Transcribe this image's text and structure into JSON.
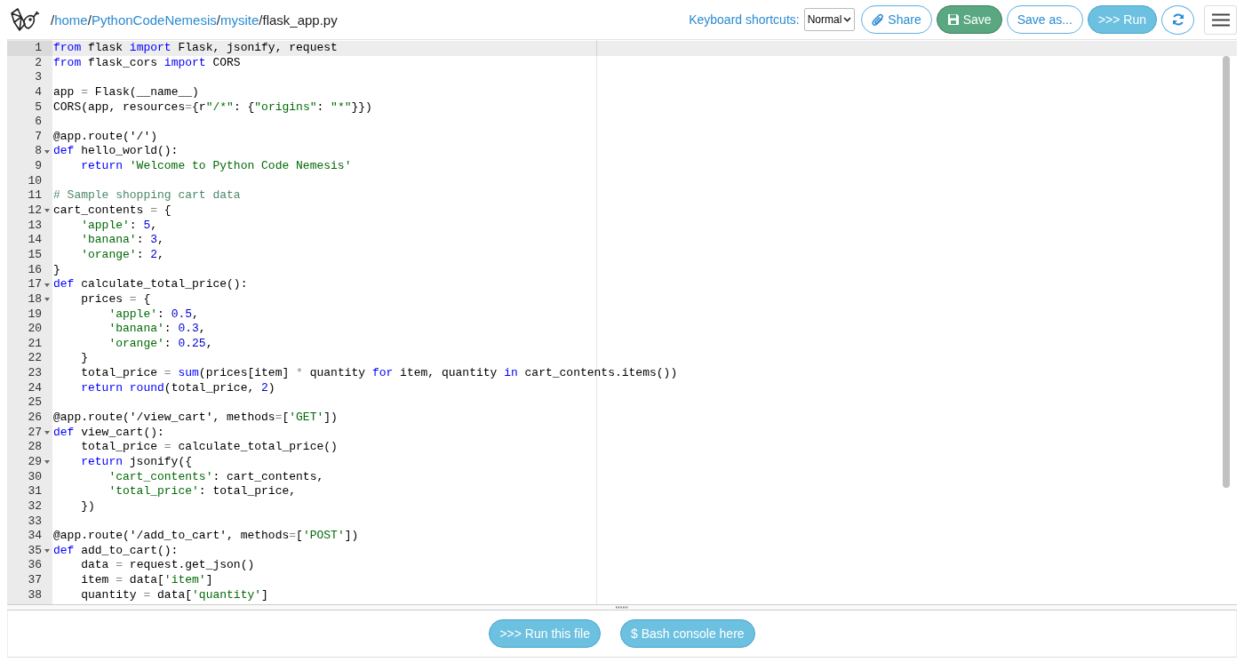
{
  "header": {
    "path": [
      {
        "kind": "sep",
        "text": "/"
      },
      {
        "kind": "link",
        "text": "home"
      },
      {
        "kind": "sep",
        "text": "/"
      },
      {
        "kind": "link",
        "text": "PythonCodeNemesis"
      },
      {
        "kind": "sep",
        "text": "/"
      },
      {
        "kind": "link",
        "text": "mysite"
      },
      {
        "kind": "sep",
        "text": "/"
      },
      {
        "kind": "file",
        "text": "flask_app.py"
      }
    ],
    "shortcuts_label": "Keyboard shortcuts:",
    "shortcuts_select": "Normal",
    "buttons": [
      {
        "kind": "share",
        "label": "Share"
      },
      {
        "kind": "save",
        "label": "Save"
      },
      {
        "kind": "save_as",
        "label": "Save as..."
      },
      {
        "kind": "run",
        "label": ">>> Run"
      },
      {
        "kind": "refresh"
      },
      {
        "kind": "menu"
      }
    ]
  },
  "editor": {
    "lines": [
      {
        "number": "1",
        "active": true,
        "foldable": false,
        "tokens": [
          {
            "kind": "kw",
            "text": "from"
          },
          {
            "kind": "plain",
            "text": " flask "
          },
          {
            "kind": "kw",
            "text": "import"
          },
          {
            "kind": "plain",
            "text": " Flask, jsonify, request"
          }
        ]
      },
      {
        "number": "2",
        "active": false,
        "foldable": false,
        "tokens": [
          {
            "kind": "kw",
            "text": "from"
          },
          {
            "kind": "plain",
            "text": " flask_cors "
          },
          {
            "kind": "kw",
            "text": "import"
          },
          {
            "kind": "plain",
            "text": " CORS"
          }
        ]
      },
      {
        "number": "3",
        "active": false,
        "foldable": false
      },
      {
        "number": "4",
        "active": false,
        "foldable": false,
        "tokens": [
          {
            "kind": "plain",
            "text": "app "
          },
          {
            "kind": "op",
            "text": "="
          },
          {
            "kind": "plain",
            "text": " Flask(__name__)"
          }
        ]
      },
      {
        "number": "5",
        "active": false,
        "foldable": false,
        "tokens": [
          {
            "kind": "plain",
            "text": "CORS(app, resources"
          },
          {
            "kind": "op",
            "text": "="
          },
          {
            "kind": "plain",
            "text": "{r"
          },
          {
            "kind": "str",
            "text": "\"/*\""
          },
          {
            "kind": "plain",
            "text": ": {"
          },
          {
            "kind": "str",
            "text": "\"origins\""
          },
          {
            "kind": "plain",
            "text": ": "
          },
          {
            "kind": "str",
            "text": "\"*\""
          },
          {
            "kind": "plain",
            "text": "}})"
          }
        ]
      },
      {
        "number": "6",
        "active": false,
        "foldable": false
      },
      {
        "number": "7",
        "active": false,
        "foldable": false,
        "tokens": [
          {
            "kind": "plain",
            "text": "@app.route('/')"
          }
        ]
      },
      {
        "number": "8",
        "active": false,
        "foldable": true,
        "tokens": [
          {
            "kind": "kw",
            "text": "def"
          },
          {
            "kind": "plain",
            "text": " hello_world():"
          }
        ]
      },
      {
        "number": "9",
        "active": false,
        "foldable": false,
        "tokens": [
          {
            "kind": "kw",
            "text": "    return"
          },
          {
            "kind": "str",
            "text": " 'Welcome to Python Code Nemesis'"
          }
        ]
      },
      {
        "number": "10",
        "active": false,
        "foldable": false
      },
      {
        "number": "11",
        "active": false,
        "foldable": false,
        "tokens": [
          {
            "kind": "com",
            "text": "# Sample shopping cart data"
          }
        ]
      },
      {
        "number": "12",
        "active": false,
        "foldable": true,
        "tokens": [
          {
            "kind": "plain",
            "text": "cart_contents "
          },
          {
            "kind": "op",
            "text": "="
          },
          {
            "kind": "plain",
            "text": " {"
          }
        ]
      },
      {
        "number": "13",
        "active": false,
        "foldable": false,
        "tokens": [
          {
            "kind": "str",
            "text": "    'apple'"
          },
          {
            "kind": "plain",
            "text": ": "
          },
          {
            "kind": "num",
            "text": "5"
          },
          {
            "kind": "plain",
            "text": ","
          }
        ]
      },
      {
        "number": "14",
        "active": false,
        "foldable": false,
        "tokens": [
          {
            "kind": "str",
            "text": "    'banana'"
          },
          {
            "kind": "plain",
            "text": ": "
          },
          {
            "kind": "num",
            "text": "3"
          },
          {
            "kind": "plain",
            "text": ","
          }
        ]
      },
      {
        "number": "15",
        "active": false,
        "foldable": false,
        "tokens": [
          {
            "kind": "str",
            "text": "    'orange'"
          },
          {
            "kind": "plain",
            "text": ": "
          },
          {
            "kind": "num",
            "text": "2"
          },
          {
            "kind": "plain",
            "text": ","
          }
        ]
      },
      {
        "number": "16",
        "active": false,
        "foldable": false,
        "tokens": [
          {
            "kind": "plain",
            "text": "}"
          }
        ]
      },
      {
        "number": "17",
        "active": false,
        "foldable": true,
        "tokens": [
          {
            "kind": "kw",
            "text": "def"
          },
          {
            "kind": "plain",
            "text": " calculate_total_price():"
          }
        ]
      },
      {
        "number": "18",
        "active": false,
        "foldable": true,
        "tokens": [
          {
            "kind": "plain",
            "text": "    prices "
          },
          {
            "kind": "op",
            "text": "="
          },
          {
            "kind": "plain",
            "text": " {"
          }
        ]
      },
      {
        "number": "19",
        "active": false,
        "foldable": false,
        "tokens": [
          {
            "kind": "str",
            "text": "        'apple'"
          },
          {
            "kind": "plain",
            "text": ": "
          },
          {
            "kind": "num",
            "text": "0.5"
          },
          {
            "kind": "plain",
            "text": ","
          }
        ]
      },
      {
        "number": "20",
        "active": false,
        "foldable": false,
        "tokens": [
          {
            "kind": "str",
            "text": "        'banana'"
          },
          {
            "kind": "plain",
            "text": ": "
          },
          {
            "kind": "num",
            "text": "0.3"
          },
          {
            "kind": "plain",
            "text": ","
          }
        ]
      },
      {
        "number": "21",
        "active": false,
        "foldable": false,
        "tokens": [
          {
            "kind": "str",
            "text": "        'orange'"
          },
          {
            "kind": "plain",
            "text": ": "
          },
          {
            "kind": "num",
            "text": "0.25"
          },
          {
            "kind": "plain",
            "text": ","
          }
        ]
      },
      {
        "number": "22",
        "active": false,
        "foldable": false,
        "tokens": [
          {
            "kind": "plain",
            "text": "    }"
          }
        ]
      },
      {
        "number": "23",
        "active": false,
        "foldable": false,
        "tokens": [
          {
            "kind": "plain",
            "text": "    total_price "
          },
          {
            "kind": "op",
            "text": "="
          },
          {
            "kind": "kw",
            "text": " sum"
          },
          {
            "kind": "plain",
            "text": "(prices[item] "
          },
          {
            "kind": "op",
            "text": "*"
          },
          {
            "kind": "plain",
            "text": " quantity "
          },
          {
            "kind": "kw",
            "text": "for"
          },
          {
            "kind": "plain",
            "text": " item, quantity "
          },
          {
            "kind": "kw",
            "text": "in"
          },
          {
            "kind": "plain",
            "text": " cart_contents.items())"
          }
        ]
      },
      {
        "number": "24",
        "active": false,
        "foldable": false,
        "tokens": [
          {
            "kind": "kw",
            "text": "    return round"
          },
          {
            "kind": "plain",
            "text": "(total_price, "
          },
          {
            "kind": "num",
            "text": "2"
          },
          {
            "kind": "plain",
            "text": ")"
          }
        ]
      },
      {
        "number": "25",
        "active": false,
        "foldable": false
      },
      {
        "number": "26",
        "active": false,
        "foldable": false,
        "tokens": [
          {
            "kind": "plain",
            "text": "@app.route('/view_cart', methods"
          },
          {
            "kind": "op",
            "text": "="
          },
          {
            "kind": "plain",
            "text": "["
          },
          {
            "kind": "str",
            "text": "'GET'"
          },
          {
            "kind": "plain",
            "text": "])"
          }
        ]
      },
      {
        "number": "27",
        "active": false,
        "foldable": true,
        "tokens": [
          {
            "kind": "kw",
            "text": "def"
          },
          {
            "kind": "plain",
            "text": " view_cart():"
          }
        ]
      },
      {
        "number": "28",
        "active": false,
        "foldable": false,
        "tokens": [
          {
            "kind": "plain",
            "text": "    total_price "
          },
          {
            "kind": "op",
            "text": "="
          },
          {
            "kind": "plain",
            "text": " calculate_total_price()"
          }
        ]
      },
      {
        "number": "29",
        "active": false,
        "foldable": true,
        "tokens": [
          {
            "kind": "kw",
            "text": "    return"
          },
          {
            "kind": "plain",
            "text": " jsonify({"
          }
        ]
      },
      {
        "number": "30",
        "active": false,
        "foldable": false,
        "tokens": [
          {
            "kind": "str",
            "text": "        'cart_contents'"
          },
          {
            "kind": "plain",
            "text": ": cart_contents,"
          }
        ]
      },
      {
        "number": "31",
        "active": false,
        "foldable": false,
        "tokens": [
          {
            "kind": "str",
            "text": "        'total_price'"
          },
          {
            "kind": "plain",
            "text": ": total_price,"
          }
        ]
      },
      {
        "number": "32",
        "active": false,
        "foldable": false,
        "tokens": [
          {
            "kind": "plain",
            "text": "    })"
          }
        ]
      },
      {
        "number": "33",
        "active": false,
        "foldable": false
      },
      {
        "number": "34",
        "active": false,
        "foldable": false,
        "tokens": [
          {
            "kind": "plain",
            "text": "@app.route('/add_to_cart', methods"
          },
          {
            "kind": "op",
            "text": "="
          },
          {
            "kind": "plain",
            "text": "["
          },
          {
            "kind": "str",
            "text": "'POST'"
          },
          {
            "kind": "plain",
            "text": "])"
          }
        ]
      },
      {
        "number": "35",
        "active": false,
        "foldable": true,
        "tokens": [
          {
            "kind": "kw",
            "text": "def"
          },
          {
            "kind": "plain",
            "text": " add_to_cart():"
          }
        ]
      },
      {
        "number": "36",
        "active": false,
        "foldable": false,
        "tokens": [
          {
            "kind": "plain",
            "text": "    data "
          },
          {
            "kind": "op",
            "text": "="
          },
          {
            "kind": "plain",
            "text": " request.get_json()"
          }
        ]
      },
      {
        "number": "37",
        "active": false,
        "foldable": false,
        "tokens": [
          {
            "kind": "plain",
            "text": "    item "
          },
          {
            "kind": "op",
            "text": "="
          },
          {
            "kind": "plain",
            "text": " data["
          },
          {
            "kind": "str",
            "text": "'item'"
          },
          {
            "kind": "plain",
            "text": "]"
          }
        ]
      },
      {
        "number": "38",
        "active": false,
        "foldable": false,
        "tokens": [
          {
            "kind": "plain",
            "text": "    quantity "
          },
          {
            "kind": "op",
            "text": "="
          },
          {
            "kind": "plain",
            "text": " data["
          },
          {
            "kind": "str",
            "text": "'quantity'"
          },
          {
            "kind": "plain",
            "text": "]"
          }
        ]
      }
    ]
  },
  "footer": {
    "buttons": [
      {
        "label": ">>> Run this file"
      },
      {
        "label": "$ Bash console here"
      }
    ]
  }
}
